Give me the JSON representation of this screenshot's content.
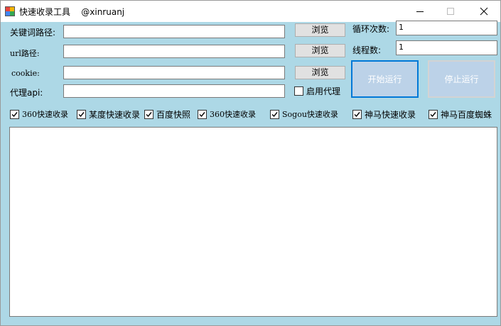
{
  "window": {
    "title": "快速收录工具    @xinruanj"
  },
  "fields": {
    "keyword_label": "关键词路径:",
    "url_label": "url路径:",
    "cookie_label": "cookie:",
    "proxy_label": "代理api:",
    "keyword_value": "",
    "url_value": "",
    "cookie_value": "",
    "proxy_value": ""
  },
  "buttons": {
    "browse1": "浏览",
    "browse2": "浏览",
    "browse3": "浏览",
    "start": "开始运行",
    "stop": "停止运行"
  },
  "proxy_checkbox": {
    "label": "启用代理",
    "checked": false
  },
  "loop": {
    "label": "循环次数:",
    "value": "1"
  },
  "threads": {
    "label": "线程数:",
    "value": "1"
  },
  "engines": [
    {
      "label": "360快速收录",
      "checked": true
    },
    {
      "label": "某度快速收录",
      "checked": true
    },
    {
      "label": "百度快照",
      "checked": true
    },
    {
      "label": "360快速收录",
      "checked": true
    },
    {
      "label": "Sogou快速收录",
      "checked": true
    },
    {
      "label": "神马快速收录",
      "checked": true
    },
    {
      "label": "神马百度蜘蛛",
      "checked": true
    }
  ],
  "log": {
    "content": ""
  },
  "colors": {
    "background": "#add8e6",
    "disabled_button": "#bcd2e8",
    "active_border": "#0078d7"
  }
}
